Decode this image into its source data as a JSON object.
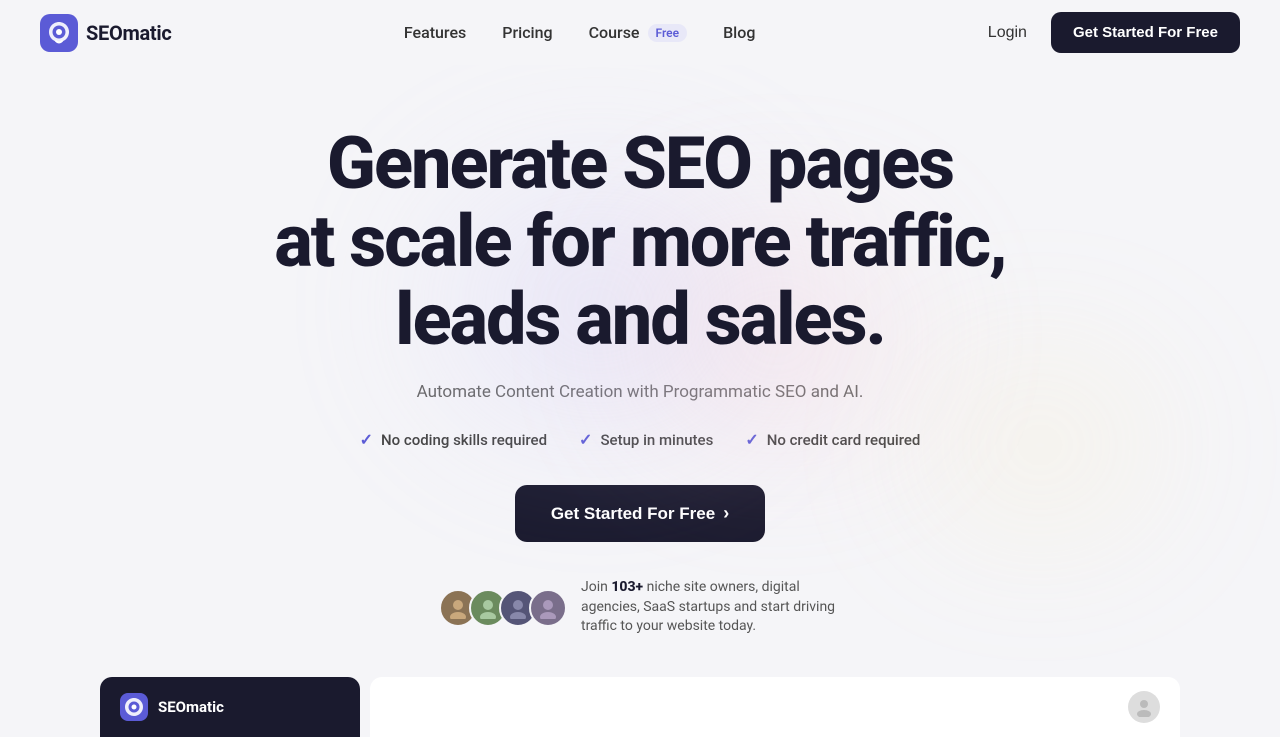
{
  "brand": {
    "name": "SEOmatic",
    "logo_alt": "SEOmatic Logo"
  },
  "nav": {
    "links": [
      {
        "label": "Features",
        "id": "features"
      },
      {
        "label": "Pricing",
        "id": "pricing"
      },
      {
        "label": "Course",
        "id": "course"
      },
      {
        "label": "Blog",
        "id": "blog"
      }
    ],
    "course_badge": "Free",
    "login_label": "Login",
    "cta_label": "Get Started For Free"
  },
  "hero": {
    "headline_line1": "Generate SEO pages",
    "headline_line2": "at scale for more traffic,",
    "headline_line3": "leads and sales.",
    "subtitle": "Automate Content Creation with Programmatic SEO and AI.",
    "checks": [
      {
        "label": "No coding skills required"
      },
      {
        "label": "Setup in minutes"
      },
      {
        "label": "No credit card required"
      }
    ],
    "cta_label": "Get Started For Free",
    "cta_arrow": "›",
    "social_count": "103+",
    "social_text_before": "Join ",
    "social_text_after": " niche site owners, digital agencies, SaaS startups and start driving traffic to your website today."
  },
  "bottom_bar": {
    "logo_text": "SEOmatic"
  }
}
